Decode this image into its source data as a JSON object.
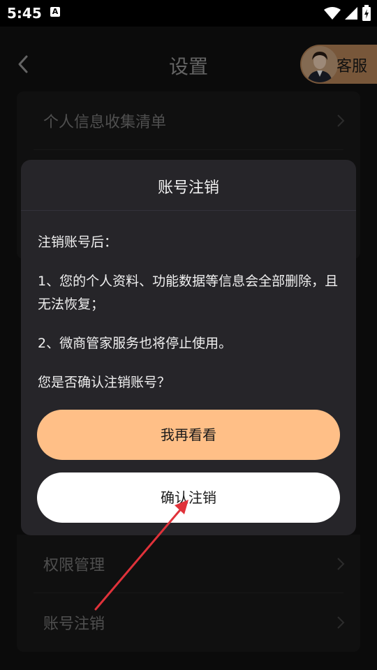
{
  "status_bar": {
    "time": "5:45",
    "badge": "A"
  },
  "header": {
    "title": "设置",
    "service_label": "客服"
  },
  "settings": {
    "top_items": [
      {
        "label": "个人信息收集清单"
      }
    ],
    "bottom_items": [
      {
        "label": "权限管理"
      },
      {
        "label": "账号注销"
      }
    ]
  },
  "dialog": {
    "title": "账号注销",
    "body": [
      "注销账号后：",
      "1、您的个人资料、功能数据等信息会全部删除，且无法恢复；",
      "2、微商管家服务也将停止使用。",
      "您是否确认注销账号？"
    ],
    "cancel_label": "我再看看",
    "confirm_label": "确认注销"
  },
  "colors": {
    "accent": "#ffbf87",
    "dialog_bg": "#262529",
    "annotation_arrow": "#e0323a"
  },
  "icons": [
    "back-arrow-icon",
    "chevron-right-icon",
    "wifi-icon",
    "signal-icon",
    "battery-icon",
    "agent-avatar-icon"
  ]
}
